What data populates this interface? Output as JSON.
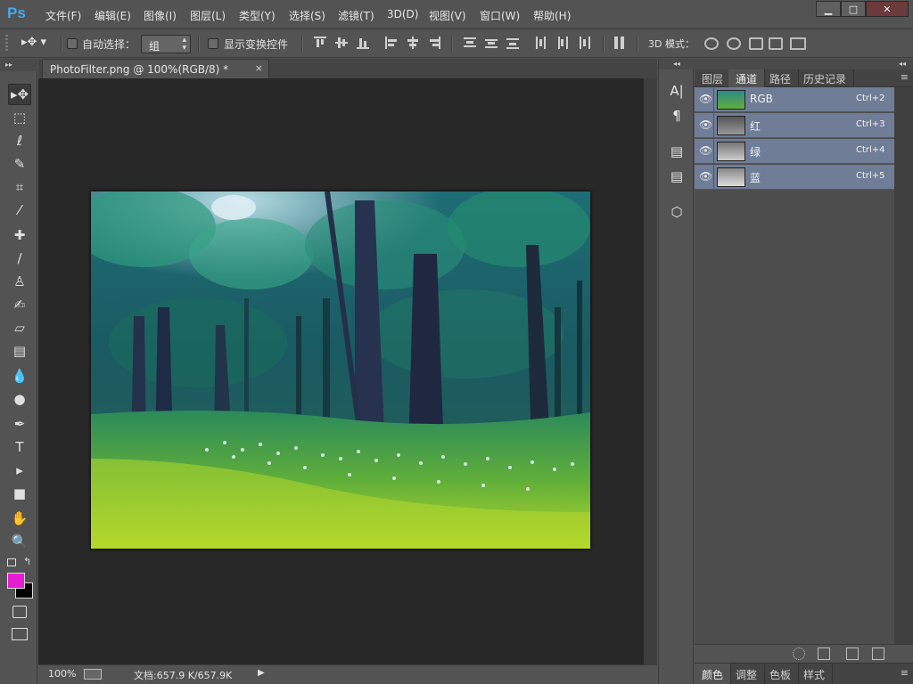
{
  "app": {
    "logo": "Ps"
  },
  "menu": [
    "文件(F)",
    "编辑(E)",
    "图像(I)",
    "图层(L)",
    "类型(Y)",
    "选择(S)",
    "滤镜(T)",
    "3D(D)",
    "视图(V)",
    "窗口(W)",
    "帮助(H)"
  ],
  "window_buttons": {
    "minimize": "▁",
    "maximize": "□",
    "close": "✕"
  },
  "options": {
    "auto_select_label": "自动选择：",
    "auto_select_checked": false,
    "auto_select_value": "组",
    "show_transform_label": "显示变换控件",
    "show_transform_checked": false,
    "mode_3d_label": "3D 模式："
  },
  "document": {
    "tab_title": "PhotoFilter.png @ 100%(RGB/8) *",
    "close": "×"
  },
  "status": {
    "zoom": "100%",
    "doc_info": "文档:657.9 K/657.9K",
    "arrow": "▶"
  },
  "panel": {
    "collapse": "◂◂",
    "tabs": [
      "图层",
      "通道",
      "路径",
      "历史记录"
    ],
    "active_tab": "通道",
    "menu_icon": "≡",
    "channels": [
      {
        "name": "RGB",
        "shortcut": "Ctrl+2",
        "visible": true,
        "thumb": "rgb"
      },
      {
        "name": "红",
        "shortcut": "Ctrl+3",
        "visible": true,
        "thumb": "gray-dark"
      },
      {
        "name": "绿",
        "shortcut": "Ctrl+4",
        "visible": true,
        "thumb": "gray"
      },
      {
        "name": "蓝",
        "shortcut": "Ctrl+5",
        "visible": true,
        "thumb": "gray-light"
      }
    ],
    "bottom_tabs": [
      "颜色",
      "调整",
      "色板",
      "样式"
    ],
    "bottom_active": "颜色"
  },
  "colors": {
    "foreground": "#e61ccf",
    "background": "#000000",
    "channel_highlight": "#6f7d97",
    "logo": "#4aa6ef"
  },
  "toolbox": {
    "collapse": "▸▸",
    "tools": [
      {
        "name": "move-tool",
        "glyph": "▸✥",
        "active": true
      },
      {
        "name": "marquee-tool",
        "glyph": "⬚"
      },
      {
        "name": "lasso-tool",
        "glyph": "ℓ"
      },
      {
        "name": "quick-select-tool",
        "glyph": "✎"
      },
      {
        "name": "crop-tool",
        "glyph": "⌗"
      },
      {
        "name": "eyedropper-tool",
        "glyph": "⁄"
      },
      {
        "name": "healing-brush-tool",
        "glyph": "✚"
      },
      {
        "name": "brush-tool",
        "glyph": "∕"
      },
      {
        "name": "clone-stamp-tool",
        "glyph": "♙"
      },
      {
        "name": "history-brush-tool",
        "glyph": "✍"
      },
      {
        "name": "eraser-tool",
        "glyph": "▱"
      },
      {
        "name": "gradient-tool",
        "glyph": "▤"
      },
      {
        "name": "blur-tool",
        "glyph": "💧"
      },
      {
        "name": "dodge-tool",
        "glyph": "●"
      },
      {
        "name": "pen-tool",
        "glyph": "✒"
      },
      {
        "name": "type-tool",
        "glyph": "T"
      },
      {
        "name": "path-select-tool",
        "glyph": "▸"
      },
      {
        "name": "rectangle-tool",
        "glyph": "■"
      },
      {
        "name": "hand-tool",
        "glyph": "✋"
      },
      {
        "name": "zoom-tool",
        "glyph": "🔍"
      }
    ]
  },
  "dock": {
    "collapse": "◂◂",
    "icons": [
      "A|",
      "¶",
      "▤",
      "▤",
      "⬡"
    ]
  }
}
